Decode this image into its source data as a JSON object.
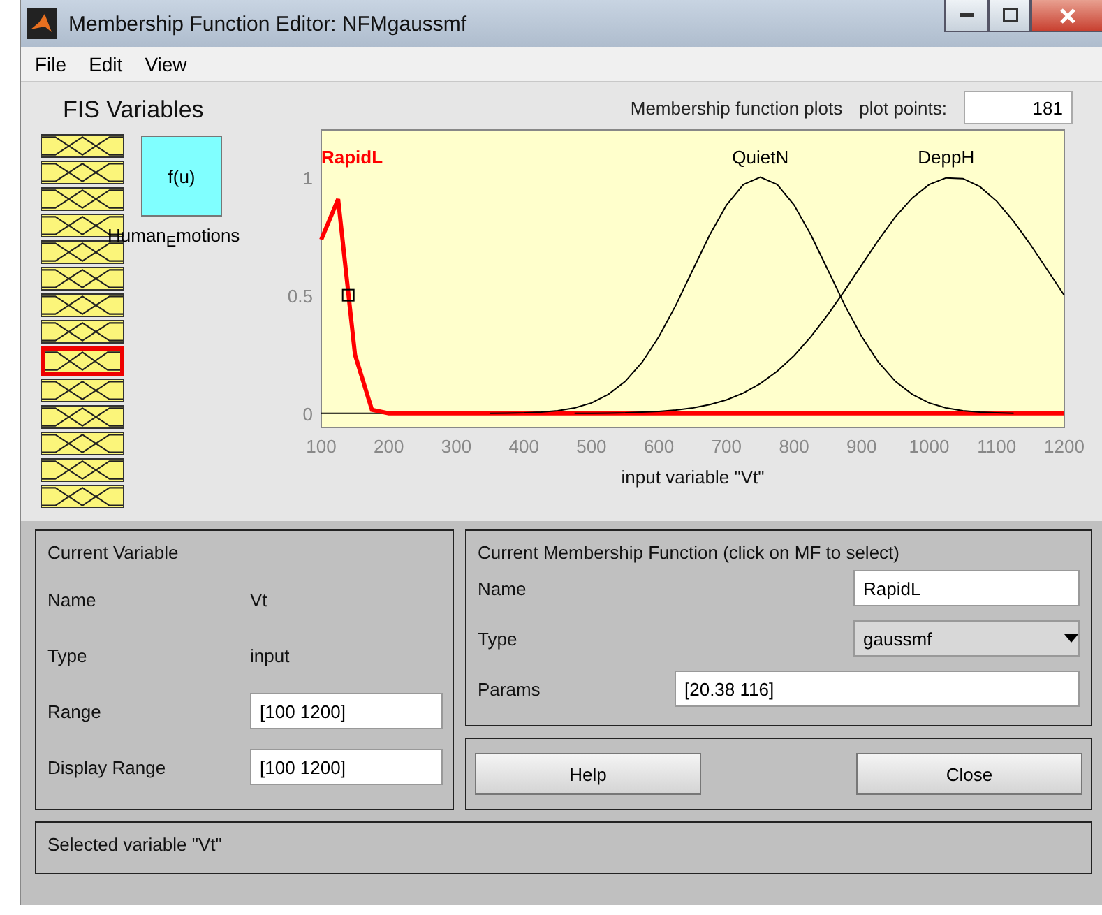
{
  "window": {
    "title": "Membership Function Editor: NFMgaussmf"
  },
  "menu": [
    "File",
    "Edit",
    "View"
  ],
  "fis_variables": {
    "title": "FIS Variables",
    "inputs": [
      {
        "selected": false
      },
      {
        "selected": false
      },
      {
        "selected": false
      },
      {
        "selected": false
      },
      {
        "selected": false
      },
      {
        "selected": false
      },
      {
        "selected": false
      },
      {
        "selected": false
      },
      {
        "selected": true
      },
      {
        "selected": false
      },
      {
        "selected": false
      },
      {
        "selected": false
      },
      {
        "selected": false
      },
      {
        "selected": false
      }
    ],
    "system_box": {
      "label": "f(u)",
      "name": "Human$_{E}$motions"
    }
  },
  "plot": {
    "title": "Membership function plots",
    "plot_points_label": "plot points:",
    "plot_points": "181",
    "chart_data": {
      "type": "line",
      "xlabel": "input variable \"Vt\"",
      "xlim": [
        100,
        1200
      ],
      "ylim": [
        -0.06,
        1.2
      ],
      "xticks": [
        100,
        200,
        300,
        400,
        500,
        600,
        700,
        800,
        900,
        1000,
        1100,
        1200
      ],
      "yticks": [
        0,
        0.5,
        1
      ],
      "x": [
        100,
        125,
        150,
        175,
        200,
        225,
        250,
        275,
        300,
        325,
        350,
        375,
        400,
        425,
        450,
        475,
        500,
        525,
        550,
        575,
        600,
        625,
        650,
        675,
        700,
        725,
        750,
        775,
        800,
        825,
        850,
        875,
        900,
        925,
        950,
        975,
        1000,
        1025,
        1050,
        1075,
        1100,
        1125,
        1150,
        1175,
        1200
      ],
      "series": [
        {
          "name": "RapidL",
          "color": "#ff0000",
          "values": [
            0.735,
            0.907,
            0.248,
            0.015,
            0,
            0,
            0,
            0,
            0,
            0,
            0,
            0,
            0,
            0,
            0,
            0,
            0,
            0,
            0,
            0,
            0,
            0,
            0,
            0,
            0,
            0,
            0,
            0,
            0,
            0,
            0,
            0,
            0,
            0,
            0,
            0,
            0,
            0,
            0,
            0,
            0,
            0,
            0,
            0,
            0
          ]
        },
        {
          "name": "QuietN",
          "color": "#000000",
          "values": [
            null,
            null,
            null,
            null,
            null,
            null,
            null,
            null,
            null,
            null,
            0,
            0.001,
            0.002,
            0.005,
            0.011,
            0.023,
            0.044,
            0.08,
            0.135,
            0.216,
            0.325,
            0.458,
            0.607,
            0.755,
            0.882,
            0.969,
            1,
            0.969,
            0.882,
            0.755,
            0.607,
            0.458,
            0.325,
            0.216,
            0.135,
            0.08,
            0.044,
            0.023,
            0.011,
            0.005,
            0.002,
            0,
            null,
            null,
            null
          ]
        },
        {
          "name": "DeppH",
          "color": "#000000",
          "values": [
            null,
            null,
            null,
            null,
            null,
            null,
            null,
            null,
            null,
            null,
            null,
            null,
            null,
            null,
            null,
            0,
            0,
            0.001,
            0.002,
            0.005,
            0.008,
            0.014,
            0.023,
            0.037,
            0.057,
            0.086,
            0.126,
            0.178,
            0.244,
            0.325,
            0.418,
            0.52,
            0.628,
            0.734,
            0.832,
            0.912,
            0.969,
            0.997,
            0.994,
            0.96,
            0.898,
            0.813,
            0.714,
            0.607,
            0.499
          ]
        }
      ]
    }
  },
  "current_variable": {
    "title": "Current Variable",
    "rows": [
      {
        "label": "Name",
        "kind": "text",
        "value": "Vt"
      },
      {
        "label": "Type",
        "kind": "text",
        "value": "input"
      },
      {
        "label": "Range",
        "kind": "field",
        "value": "[100 1200]"
      },
      {
        "label": "Display Range",
        "kind": "field",
        "value": "[100 1200]"
      }
    ]
  },
  "current_mf": {
    "title": "Current Membership Function (click on MF to select)",
    "rows": [
      {
        "label": "Name",
        "kind": "field",
        "value": "RapidL"
      },
      {
        "label": "Type",
        "kind": "dropdown",
        "value": "gaussmf"
      },
      {
        "label": "Params",
        "kind": "wide",
        "value": "[20.38 116]"
      }
    ]
  },
  "buttons": [
    "Help",
    "Close"
  ],
  "status": "Selected variable \"Vt\""
}
